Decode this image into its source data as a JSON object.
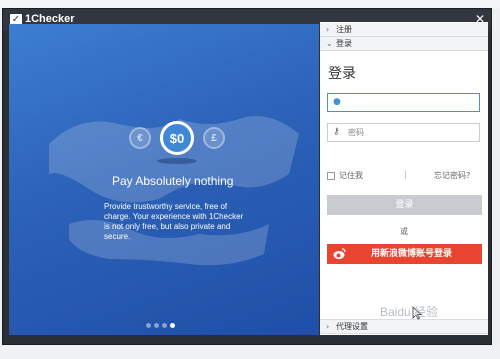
{
  "window": {
    "title": "1Checker",
    "min_glyph": "_",
    "close_glyph": "✕"
  },
  "promo": {
    "coin_left": "€",
    "coin_center": "$0",
    "coin_right": "£",
    "title": "Pay Absolutely nothing",
    "description": "Provide trustworthy service, free of charge. Your experience with 1Checker is not only free, but also private and secure.",
    "dots": 4,
    "active_dot": 3
  },
  "right_panel": {
    "register_label": "注册",
    "login_section_label": "登录",
    "login_heading": "登录",
    "username_placeholder": "",
    "password_placeholder": "密码",
    "remember_label": "记住我",
    "forgot_label": "忘记密码?",
    "login_button": "登录",
    "or_text": "或",
    "weibo_button": "用新浪微博账号登录",
    "proxy_label": "代理设置"
  },
  "colors": {
    "weibo_red": "#e8442f",
    "accent_blue": "#4a90d9",
    "login_button_gray": "#c8cbd0"
  },
  "watermark": "Baidu 经验"
}
